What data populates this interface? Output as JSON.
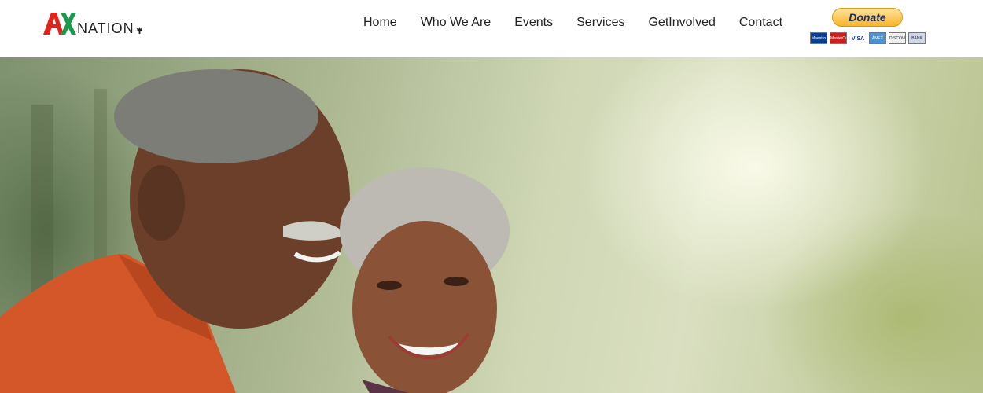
{
  "brand": {
    "logo_mark": "AX",
    "logo_text": "NATION"
  },
  "nav": {
    "items": [
      {
        "label": "Home"
      },
      {
        "label": "Who We Are"
      },
      {
        "label": "Events"
      },
      {
        "label": "Services"
      },
      {
        "label": "GetInvolved"
      },
      {
        "label": "Contact"
      }
    ]
  },
  "donate": {
    "label": "Donate",
    "cards": [
      "Maestro",
      "MasterCard",
      "VISA",
      "AMEX",
      "DISCOVER",
      "BANK"
    ]
  },
  "hero": {
    "image": "couple-outdoors-photo"
  },
  "colors": {
    "logo_red": "#e2231a",
    "logo_green": "#1a9a4a",
    "nav_text": "#222222",
    "donate_gold": "#f7b52c"
  }
}
